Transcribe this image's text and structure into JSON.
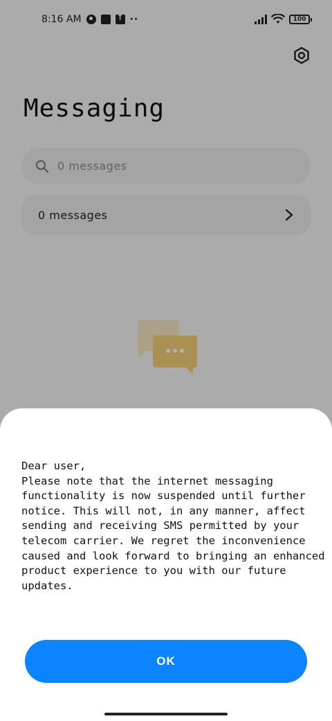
{
  "status_bar": {
    "time": "8:16 AM",
    "more": "··",
    "battery": "100"
  },
  "header": {
    "title": "Messaging",
    "settings_icon": "settings-gear-icon"
  },
  "search": {
    "placeholder": "0 messages",
    "icon": "search-icon"
  },
  "conversations_row": {
    "label": "0 messages",
    "icon": "chevron-right-icon"
  },
  "empty_state": {
    "icon": "chat-bubbles-icon",
    "accent_color": "#f5c04a"
  },
  "dialog": {
    "message": "Dear user,\nPlease note that the internet messaging\nfunctionality is now suspended until further\nnotice. This will not, in any manner, affect\nsending and receiving SMS permitted by your\ntelecom carrier. We regret the inconvenience\ncaused and look forward to bringing an enhanced\nproduct experience to you with our future\nupdates.",
    "ok_label": "OK",
    "button_color": "#0d84ff"
  }
}
